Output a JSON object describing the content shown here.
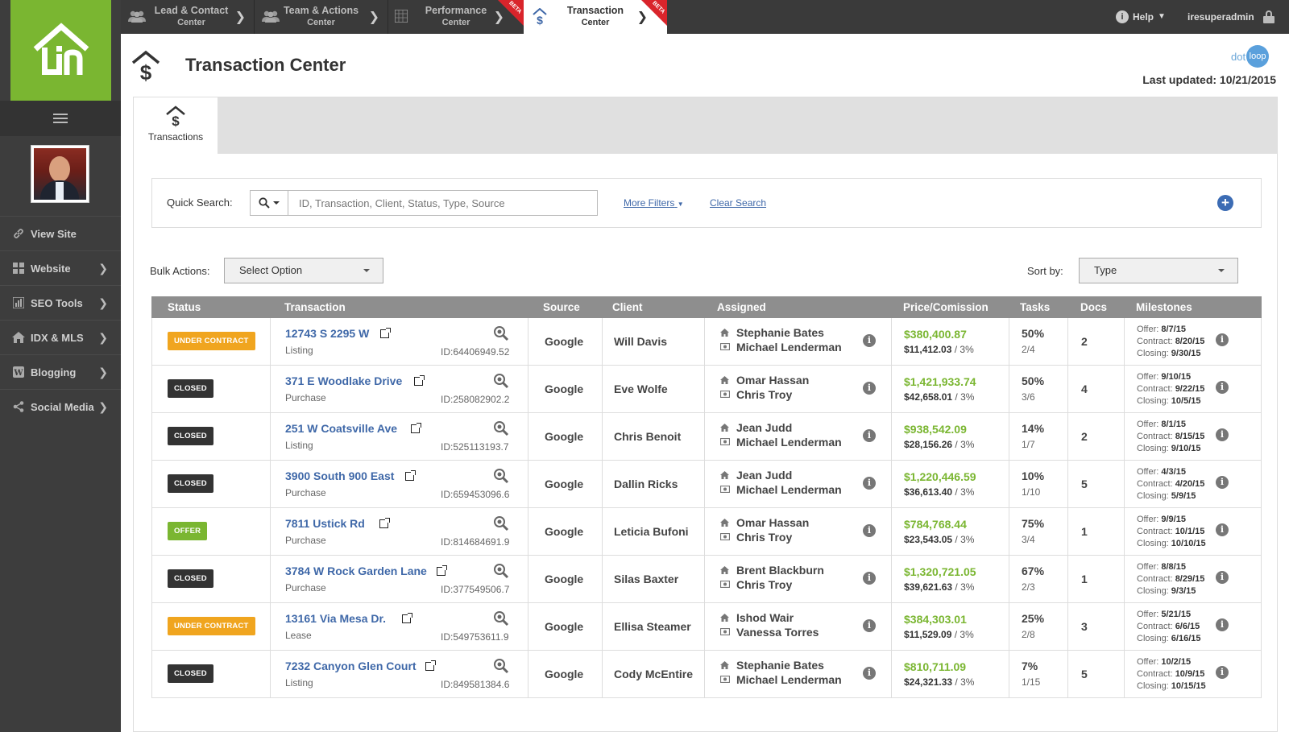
{
  "app": {
    "brand_colors": {
      "green": "#7ab631",
      "orange": "#f0a51f",
      "dark": "#333333",
      "link": "#3f68a8",
      "red_beta": "#d9242b"
    }
  },
  "topnav": {
    "tabs": [
      {
        "line1": "Lead & Contact",
        "line2": "Center",
        "icon": "people-icon"
      },
      {
        "line1": "Team & Actions",
        "line2": "Center",
        "icon": "team-icon"
      },
      {
        "line1": "Performance",
        "line2": "Center",
        "icon": "chart-icon",
        "beta": "BETA"
      },
      {
        "line1": "Transaction",
        "line2": "Center",
        "icon": "dollar-icon",
        "beta": "BETA",
        "active": true
      }
    ],
    "help_label": "Help",
    "user_label": "iresuperadmin"
  },
  "sidebar": {
    "logo_text": "lin",
    "items": [
      {
        "label": "View Site",
        "icon": "link-icon"
      },
      {
        "label": "Website",
        "icon": "grid-icon"
      },
      {
        "label": "SEO Tools",
        "icon": "bar-chart-icon"
      },
      {
        "label": "IDX & MLS",
        "icon": "home-icon"
      },
      {
        "label": "Blogging",
        "icon": "wordpress-icon"
      },
      {
        "label": "Social Media",
        "icon": "share-icon"
      }
    ]
  },
  "header": {
    "title": "Transaction Center",
    "dotloop_text": "dot",
    "dotloop_circle": "loop",
    "last_updated": "Last updated: 10/21/2015"
  },
  "tabs": [
    {
      "label": "Transactions"
    }
  ],
  "search": {
    "label": "Quick Search:",
    "placeholder": "ID, Transaction, Client, Status, Type, Source",
    "more_filters": "More Filters",
    "clear_search": "Clear Search",
    "add_symbol": "+"
  },
  "bulk": {
    "label": "Bulk Actions:",
    "selected": "Select Option"
  },
  "sort": {
    "label": "Sort by:",
    "selected": "Type"
  },
  "table": {
    "headers": [
      "Status",
      "Transaction",
      "Source",
      "Client",
      "Assigned",
      "Price/Comission",
      "Tasks",
      "Docs",
      "Milestones"
    ],
    "rows": [
      {
        "status": "UNDER CONTRACT",
        "status_class": "b-under",
        "address": "12743 S 2295 W",
        "type": "Listing",
        "id": "ID:64406949.52",
        "source": "Google",
        "client": "Will Davis",
        "agent1": "Stephanie Bates",
        "agent2": "Michael Lenderman",
        "price": "$380,400.87",
        "comm_amount": "$11,412.03",
        "comm_rate": " / 3%",
        "tasks_pct": "50%",
        "tasks_frac": "2/4",
        "docs": "2",
        "offer_label": "Offer: ",
        "offer": "8/7/15",
        "contract_label": "Contract: ",
        "contract": "8/20/15",
        "closing_label": "Closing: ",
        "closing": "9/30/15"
      },
      {
        "status": "CLOSED",
        "status_class": "b-closed",
        "address": "371 E Woodlake Drive",
        "type": "Purchase",
        "id": "ID:258082902.2",
        "source": "Google",
        "client": "Eve Wolfe",
        "agent1": "Omar Hassan",
        "agent2": "Chris Troy",
        "price": "$1,421,933.74",
        "comm_amount": "$42,658.01",
        "comm_rate": " / 3%",
        "tasks_pct": "50%",
        "tasks_frac": "3/6",
        "docs": "4",
        "offer_label": "Offer: ",
        "offer": "9/10/15",
        "contract_label": "Contract: ",
        "contract": "9/22/15",
        "closing_label": "Closing: ",
        "closing": "10/5/15"
      },
      {
        "status": "CLOSED",
        "status_class": "b-closed",
        "address": "251 W Coatsville Ave",
        "type": "Listing",
        "id": "ID:525113193.7",
        "source": "Google",
        "client": "Chris Benoit",
        "agent1": "Jean Judd",
        "agent2": "Michael Lenderman",
        "price": "$938,542.09",
        "comm_amount": "$28,156.26",
        "comm_rate": " / 3%",
        "tasks_pct": "14%",
        "tasks_frac": "1/7",
        "docs": "2",
        "offer_label": "Offer: ",
        "offer": "8/1/15",
        "contract_label": "Contract: ",
        "contract": "8/15/15",
        "closing_label": "Closing: ",
        "closing": "9/10/15"
      },
      {
        "status": "CLOSED",
        "status_class": "b-closed",
        "address": "3900 South 900 East",
        "type": "Purchase",
        "id": "ID:659453096.6",
        "source": "Google",
        "client": "Dallin Ricks",
        "agent1": "Jean Judd",
        "agent2": "Michael Lenderman",
        "price": "$1,220,446.59",
        "comm_amount": "$36,613.40",
        "comm_rate": " / 3%",
        "tasks_pct": "10%",
        "tasks_frac": "1/10",
        "docs": "5",
        "offer_label": "Offer: ",
        "offer": "4/3/15",
        "contract_label": "Contract: ",
        "contract": "4/20/15",
        "closing_label": "Closing: ",
        "closing": "5/9/15"
      },
      {
        "status": "OFFER",
        "status_class": "b-offer",
        "address": "7811 Ustick Rd",
        "type": "Purchase",
        "id": "ID:814684691.9",
        "source": "Google",
        "client": "Leticia Bufoni",
        "agent1": "Omar Hassan",
        "agent2": "Chris Troy",
        "price": "$784,768.44",
        "comm_amount": "$23,543.05",
        "comm_rate": " / 3%",
        "tasks_pct": "75%",
        "tasks_frac": "3/4",
        "docs": "1",
        "offer_label": "Offer: ",
        "offer": "9/9/15",
        "contract_label": "Contract: ",
        "contract": "10/1/15",
        "closing_label": "Closing: ",
        "closing": "10/10/15"
      },
      {
        "status": "CLOSED",
        "status_class": "b-closed",
        "address": "3784 W Rock Garden Lane",
        "type": "Purchase",
        "id": "ID:377549506.7",
        "source": "Google",
        "client": "Silas Baxter",
        "agent1": "Brent Blackburn",
        "agent2": "Chris Troy",
        "price": "$1,320,721.05",
        "comm_amount": "$39,621.63",
        "comm_rate": " / 3%",
        "tasks_pct": "67%",
        "tasks_frac": "2/3",
        "docs": "1",
        "offer_label": "Offer: ",
        "offer": "8/8/15",
        "contract_label": "Contract: ",
        "contract": "8/29/15",
        "closing_label": "Closing: ",
        "closing": "9/3/15"
      },
      {
        "status": "UNDER CONTRACT",
        "status_class": "b-under",
        "address": "13161 Via Mesa Dr.",
        "type": "Lease",
        "id": "ID:549753611.9",
        "source": "Google",
        "client": "Ellisa Steamer",
        "agent1": "Ishod Wair",
        "agent2": "Vanessa Torres",
        "price": "$384,303.01",
        "comm_amount": "$11,529.09",
        "comm_rate": " / 3%",
        "tasks_pct": "25%",
        "tasks_frac": "2/8",
        "docs": "3",
        "offer_label": "Offer: ",
        "offer": "5/21/15",
        "contract_label": "Contract: ",
        "contract": "6/6/15",
        "closing_label": "Closing: ",
        "closing": "6/16/15"
      },
      {
        "status": "CLOSED",
        "status_class": "b-closed",
        "address": "7232 Canyon Glen Court",
        "type": "Listing",
        "id": "ID:849581384.6",
        "source": "Google",
        "client": "Cody McEntire",
        "agent1": "Stephanie Bates",
        "agent2": "Michael Lenderman",
        "price": "$810,711.09",
        "comm_amount": "$24,321.33",
        "comm_rate": " / 3%",
        "tasks_pct": "7%",
        "tasks_frac": "1/15",
        "docs": "5",
        "offer_label": "Offer: ",
        "offer": "10/2/15",
        "contract_label": "Contract: ",
        "contract": "10/9/15",
        "closing_label": "Closing: ",
        "closing": "10/15/15"
      }
    ]
  }
}
